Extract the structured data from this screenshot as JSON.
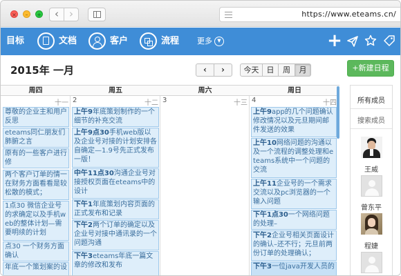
{
  "browser": {
    "url": "https://www.eteams.cn/"
  },
  "appbar": {
    "items": [
      {
        "label": "目标"
      },
      {
        "label": "文档"
      },
      {
        "label": "客户"
      },
      {
        "label": "流程"
      }
    ],
    "more_label": "更多"
  },
  "calendar": {
    "month_title": "2015年 一月",
    "prev_label": "‹",
    "next_label": "›",
    "view_today": "今天",
    "view_day": "日",
    "view_week": "周",
    "view_month": "月",
    "new_button": "+新建日程",
    "day_headers": [
      "周四",
      "周五",
      "周六",
      "周日"
    ],
    "days": [
      {
        "num": "",
        "lunar": "十一"
      },
      {
        "num": "2",
        "lunar": "十二"
      },
      {
        "num": "3",
        "lunar": "十三"
      },
      {
        "num": "4",
        "lunar": "十四"
      }
    ],
    "events_thu": [
      "尊敬的企业主和用户反思",
      "eteams同仁朋友们肺腑之言",
      "原有的一些客户进行修",
      "两个客户订单的情一在财务方面看看是较松散的模式；",
      "1点30 微信企业号的求确定以及手机web的整体计划—需要明续的计划",
      "点30 一个财务方面确认",
      "年底一个策划案的设"
    ],
    "events_fri": [
      {
        "time": "上午9",
        "text": "年底策划制作的一个细节的补充交流"
      },
      {
        "time": "上午9点30",
        "text": "手机web版以及企业号对接的计划安排各自确定—1.9号先正式发布一版！"
      },
      {
        "time": "中午11点30",
        "text": "沟通企业号对接授权页面在eteams中的设计"
      },
      {
        "time": "下午1",
        "text": "年底策划内容页面的正式发布和记录"
      },
      {
        "time": "下午2",
        "text": "两个订单的确定以及企业号对接中通讯录的一个问题沟通"
      },
      {
        "time": "下午3",
        "text": "eteams年底一篇文章的修改和发布"
      }
    ],
    "events_sun": [
      {
        "time": "上午9",
        "text": "app的几个问题确认修改情况以及元旦期间邮件发送的效果"
      },
      {
        "time": "上午10",
        "text": "网络问题的沟通以及一个流程的调整处理和eteams系统中一个问题的交流"
      },
      {
        "time": "上午11",
        "text": "企业号的一个需求交流以及pc浏览器的一个输入问题"
      },
      {
        "time": "下午1点30",
        "text": "一个网络问题的处理–"
      },
      {
        "time": "下午2",
        "text": "企业号相关页面设计的确认–还不行；元旦前两份订单的处理确认；"
      },
      {
        "time": "下午3",
        "text": "一位java开发人员的"
      }
    ]
  },
  "members": {
    "all_label": "所有成员",
    "search_label": "搜索成员",
    "list": [
      {
        "name": "王威"
      },
      {
        "name": "曾东平"
      },
      {
        "name": "程婕"
      }
    ]
  }
}
